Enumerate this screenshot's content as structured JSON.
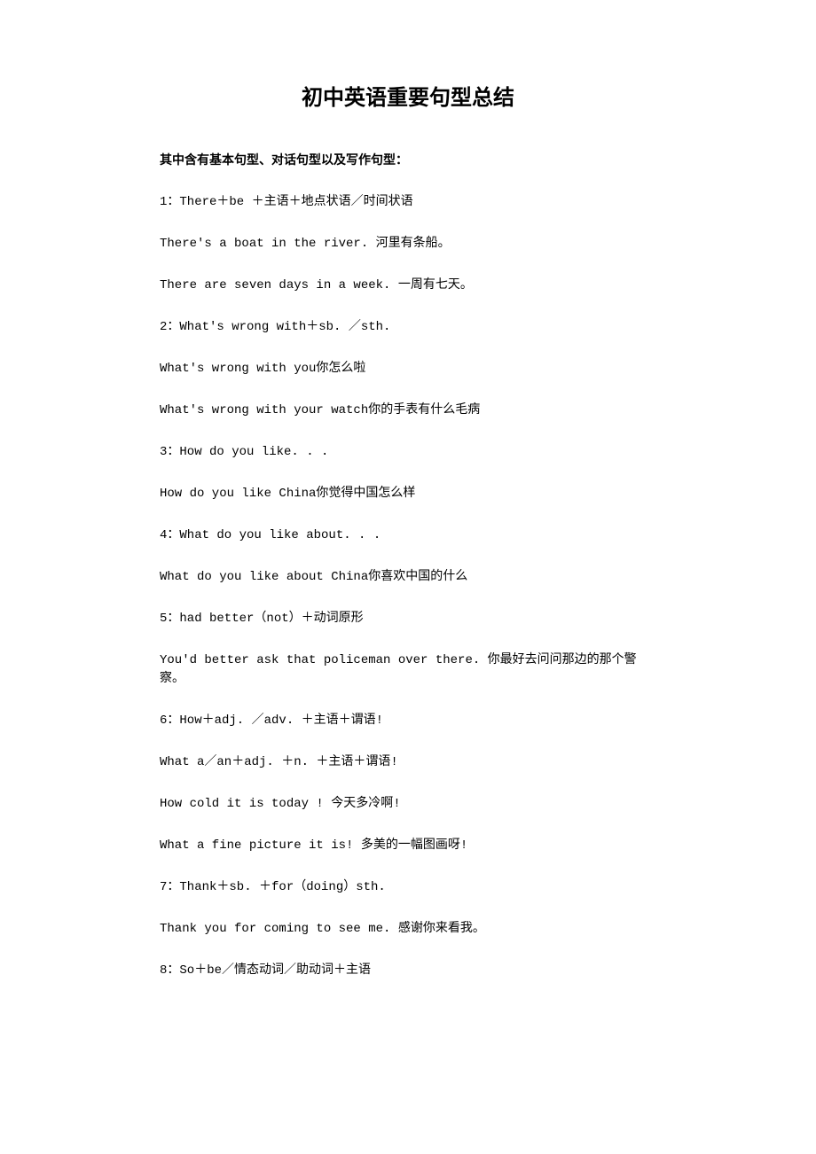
{
  "title": "初中英语重要句型总结",
  "subtitle": "其中含有基本句型、对话句型以及写作句型：",
  "lines": [
    "1：There＋be ＋主语＋地点状语／时间状语",
    "There's a boat in the river. 河里有条船。",
    "There are seven days in a week. 一周有七天。",
    "2：What's wrong with＋sb. ／sth.",
    "What's wrong with you你怎么啦",
    "What's wrong with your watch你的手表有什么毛病",
    "3：How do you like. . .",
    "How do you like China你觉得中国怎么样",
    "4：What do you like about. . .",
    "What do you like about China你喜欢中国的什么",
    "5：had better（not）＋动词原形",
    "You'd better ask that policeman over there. 你最好去问问那边的那个警察。",
    "6：How＋adj. ／adv. ＋主语＋谓语!",
    "What a／an＋adj. ＋n. ＋主语＋谓语!",
    "How cold it is today ! 今天多冷啊!",
    "What a fine picture it is! 多美的一幅图画呀!",
    "7：Thank＋sb. ＋for（doing）sth.",
    "Thank you for coming to see me. 感谢你来看我。",
    "8：So＋be／情态动词／助动词＋主语"
  ]
}
